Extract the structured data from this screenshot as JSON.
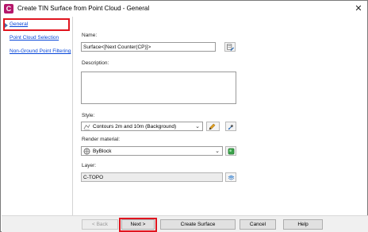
{
  "window": {
    "title": "Create TIN Surface from Point Cloud - General",
    "app_icon_glyph": "C",
    "close_glyph": "✕"
  },
  "nav": {
    "items": [
      {
        "label": "General",
        "active": true
      },
      {
        "label": "Point Cloud Selection",
        "active": false
      },
      {
        "label": "Non-Ground Point Filtering",
        "active": false
      }
    ]
  },
  "form": {
    "name_label": "Name:",
    "name_value": "Surface<[Next Counter(CP)]>",
    "description_label": "Description:",
    "description_value": "",
    "style_label": "Style:",
    "style_value": "Contours 2m and 10m (Background)",
    "render_label": "Render material:",
    "render_value": "ByBlock",
    "layer_label": "Layer:",
    "layer_value": "C-TOPO"
  },
  "footer": {
    "back_label": "< Back",
    "next_label": "Next >",
    "create_label": "Create Surface",
    "cancel_label": "Cancel",
    "help_label": "Help"
  },
  "colors": {
    "highlight": "#e0141e",
    "link": "#0645d8",
    "app_icon": "#b5176b"
  },
  "icons": {
    "name_edit": "name-template-icon",
    "style_edit": "style-edit-icon",
    "style_pick": "style-pick-icon",
    "render_browse": "render-material-icon",
    "layer_browse": "layer-icon"
  }
}
